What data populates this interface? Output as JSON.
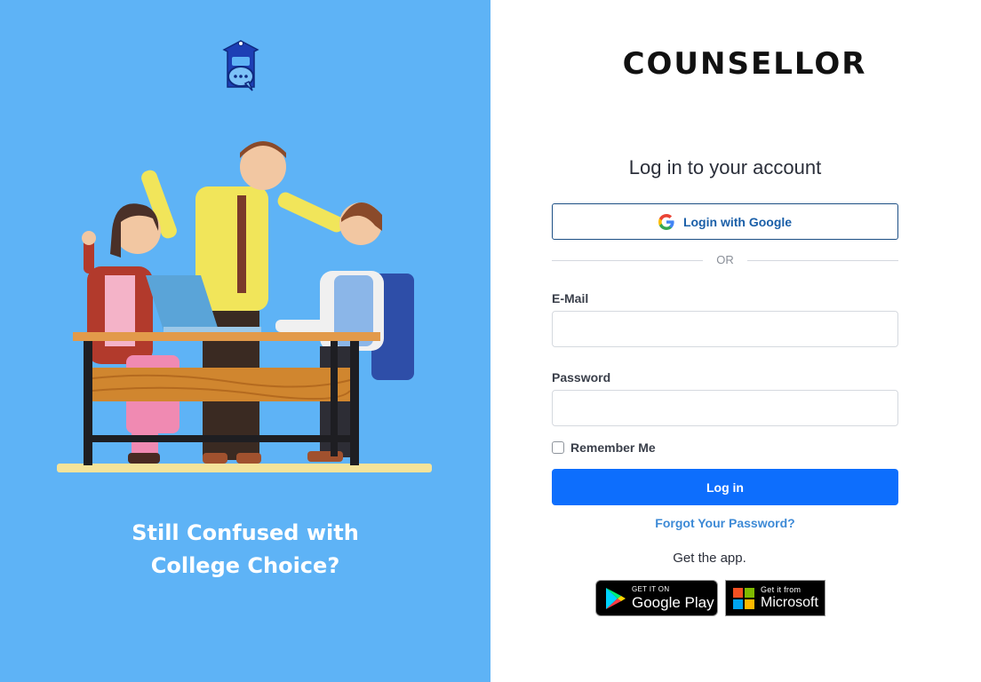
{
  "left_panel": {
    "tagline_line1": "Still Confused with",
    "tagline_line2": "College Choice?",
    "logo_icon": "chat-bubble-building-icon",
    "illustration": "three-people-at-desk-illustration",
    "bg_color": "#5eb3f6"
  },
  "right_panel": {
    "brand": "COUNSELLOR",
    "heading": "Log in to your account",
    "google_login_label": "Login with Google",
    "divider_text": "OR",
    "email_label": "E-Mail",
    "email_value": "",
    "email_placeholder": "",
    "password_label": "Password",
    "password_value": "",
    "password_placeholder": "",
    "remember_label": "Remember Me",
    "remember_checked": false,
    "login_label": "Log in",
    "forgot_label": "Forgot Your Password?",
    "get_app_label": "Get the app.",
    "google_play": {
      "small": "GET IT ON",
      "big": "Google Play"
    },
    "microsoft": {
      "small": "Get it from",
      "big": "Microsoft"
    },
    "accent_color": "#0d6efd",
    "link_color": "#3d8ad6"
  }
}
